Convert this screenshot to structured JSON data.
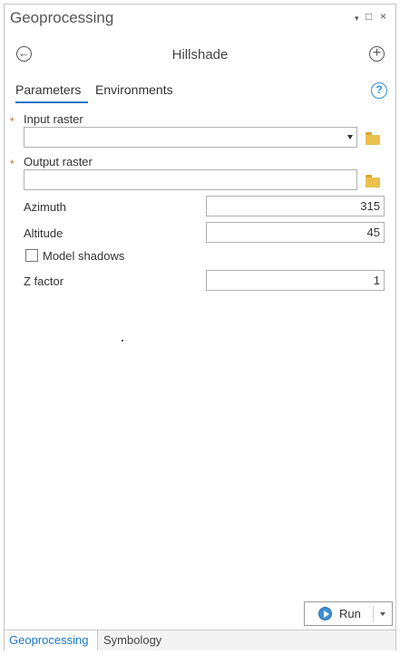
{
  "window": {
    "title": "Geoprocessing",
    "pin_glyph": "▾",
    "maximize_glyph": "□",
    "close_glyph": "×"
  },
  "tool": {
    "name": "Hillshade",
    "back_glyph": "←",
    "add_glyph": "+"
  },
  "tabs": {
    "parameters": "Parameters",
    "environments": "Environments",
    "help_glyph": "?"
  },
  "params": {
    "input_raster": {
      "label": "Input raster",
      "value": "",
      "required_marker": "*"
    },
    "output_raster": {
      "label": "Output raster",
      "value": "",
      "required_marker": "*"
    },
    "azimuth": {
      "label": "Azimuth",
      "value": "315"
    },
    "altitude": {
      "label": "Altitude",
      "value": "45"
    },
    "model_shadows": {
      "label": "Model shadows",
      "checked": false
    },
    "z_factor": {
      "label": "Z factor",
      "value": "1"
    }
  },
  "run": {
    "label": "Run"
  },
  "bottom_tabs": {
    "geoprocessing": "Geoprocessing",
    "symbology": "Symbology"
  },
  "colors": {
    "accent": "#1a75c7",
    "required": "#c46a2a",
    "folder": "#e9c04b"
  }
}
